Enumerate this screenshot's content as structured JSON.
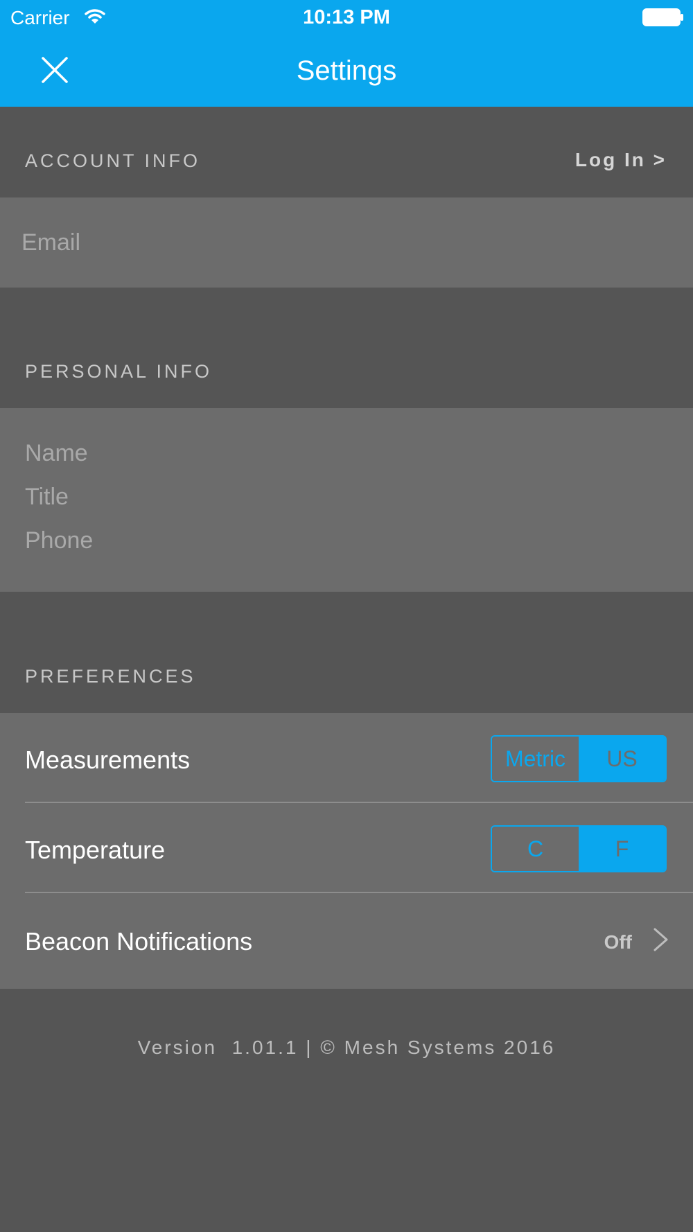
{
  "status_bar": {
    "carrier": "Carrier",
    "time": "10:13 PM"
  },
  "nav": {
    "title": "Settings",
    "close_icon": "close-icon"
  },
  "account_info": {
    "header": "ACCOUNT INFO",
    "login_label": "Log In >",
    "email_placeholder": "Email",
    "email_value": ""
  },
  "personal_info": {
    "header": "PERSONAL INFO",
    "name_placeholder": "Name",
    "title_placeholder": "Title",
    "phone_placeholder": "Phone"
  },
  "preferences": {
    "header": "PREFERENCES",
    "measurements": {
      "label": "Measurements",
      "options": [
        "Metric",
        "US"
      ],
      "selected": "US"
    },
    "temperature": {
      "label": "Temperature",
      "options": [
        "C",
        "F"
      ],
      "selected": "F"
    },
    "beacon": {
      "label": "Beacon Notifications",
      "value": "Off"
    }
  },
  "footer": {
    "text": "Version  1.01.1 | © Mesh Systems 2016"
  },
  "colors": {
    "accent": "#0aa7ee",
    "background": "#555555",
    "panel": "#6c6c6c"
  }
}
